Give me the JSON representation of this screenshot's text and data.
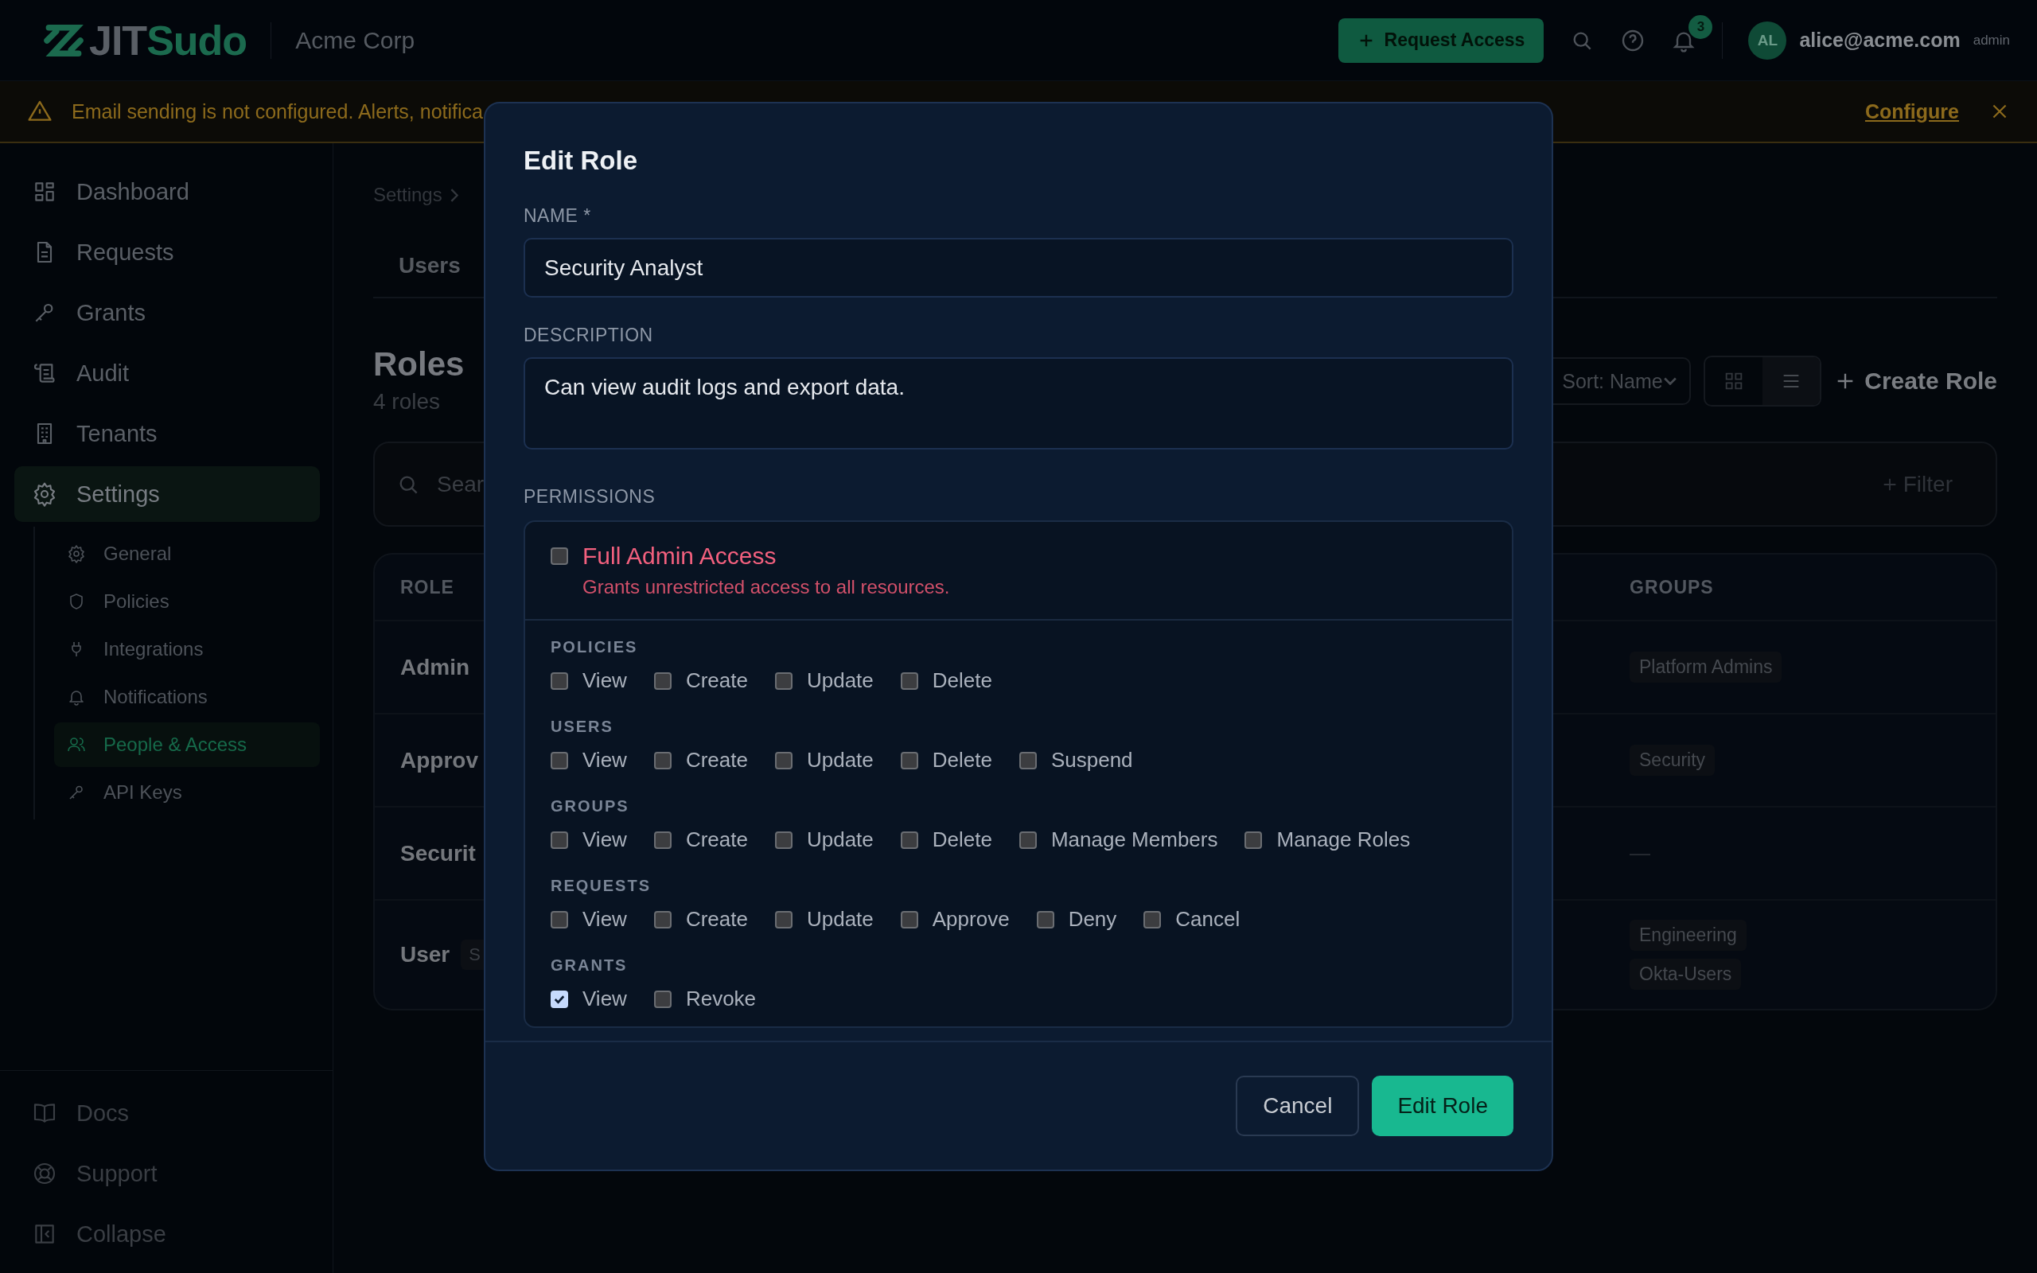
{
  "header": {
    "logo": [
      "JIT",
      "Sudo"
    ],
    "org": "Acme Corp",
    "request_button": "Request Access",
    "notification_count": "3",
    "user": {
      "initials": "AL",
      "email": "alice@acme.com",
      "role": "admin"
    }
  },
  "banner": {
    "message": "Email sending is not configured. Alerts, notifica",
    "link": "Configure"
  },
  "sidebar": {
    "items": [
      {
        "label": "Dashboard",
        "selected": false
      },
      {
        "label": "Requests",
        "selected": false
      },
      {
        "label": "Grants",
        "selected": false
      },
      {
        "label": "Audit",
        "selected": false
      },
      {
        "label": "Tenants",
        "selected": false
      },
      {
        "label": "Settings",
        "selected": true,
        "children": [
          {
            "label": "General",
            "selected": false
          },
          {
            "label": "Policies",
            "selected": false
          },
          {
            "label": "Integrations",
            "selected": false
          },
          {
            "label": "Notifications",
            "selected": false
          },
          {
            "label": "People & Access",
            "selected": true
          },
          {
            "label": "API Keys",
            "selected": false
          }
        ]
      }
    ],
    "footer": [
      "Docs",
      "Support",
      "Collapse"
    ]
  },
  "page": {
    "breadcrumb": "Settings",
    "tabs": [
      {
        "label": "Users",
        "selected": false
      }
    ],
    "title": "Roles",
    "subtitle": "4 roles",
    "sort": "Sort: Name",
    "view_modes": [
      {
        "selected": false
      },
      {
        "selected": true
      }
    ],
    "create_button": "Create Role",
    "search_placeholder": "Sear",
    "filter_button": "Filter",
    "table": {
      "columns": [
        "ROLE",
        "GROUPS"
      ],
      "rows": [
        {
          "role": "Admin",
          "groups": [
            "Platform Admins"
          ]
        },
        {
          "role": "Approv",
          "groups": [
            "Security"
          ]
        },
        {
          "role": "Securit",
          "groups_placeholder": "—"
        },
        {
          "role": "User",
          "badge": "S",
          "groups": [
            "Engineering",
            "Okta-Users"
          ]
        }
      ]
    }
  },
  "dialog": {
    "title": "Edit Role",
    "fields": [
      {
        "label": "NAME *",
        "value": "Security Analyst"
      },
      {
        "label": "DESCRIPTION",
        "value": "Can view audit logs and export data."
      }
    ],
    "permissions_label": "PERMISSIONS",
    "full_admin": {
      "label": "Full Admin Access",
      "description": "Grants unrestricted access to all resources.",
      "checked": false
    },
    "permissions": [
      {
        "name": "POLICIES",
        "options": [
          {
            "label": "View",
            "checked": false
          },
          {
            "label": "Create",
            "checked": false
          },
          {
            "label": "Update",
            "checked": false
          },
          {
            "label": "Delete",
            "checked": false
          }
        ]
      },
      {
        "name": "USERS",
        "options": [
          {
            "label": "View",
            "checked": false
          },
          {
            "label": "Create",
            "checked": false
          },
          {
            "label": "Update",
            "checked": false
          },
          {
            "label": "Delete",
            "checked": false
          },
          {
            "label": "Suspend",
            "checked": false
          }
        ]
      },
      {
        "name": "GROUPS",
        "options": [
          {
            "label": "View",
            "checked": false
          },
          {
            "label": "Create",
            "checked": false
          },
          {
            "label": "Update",
            "checked": false
          },
          {
            "label": "Delete",
            "checked": false
          },
          {
            "label": "Manage Members",
            "checked": false
          },
          {
            "label": "Manage Roles",
            "checked": false
          }
        ]
      },
      {
        "name": "REQUESTS",
        "options": [
          {
            "label": "View",
            "checked": false
          },
          {
            "label": "Create",
            "checked": false
          },
          {
            "label": "Update",
            "checked": false
          },
          {
            "label": "Approve",
            "checked": false
          },
          {
            "label": "Deny",
            "checked": false
          },
          {
            "label": "Cancel",
            "checked": false
          }
        ]
      },
      {
        "name": "GRANTS",
        "options": [
          {
            "label": "View",
            "checked": true
          },
          {
            "label": "Revoke",
            "checked": false
          }
        ]
      }
    ],
    "buttons": {
      "cancel": "Cancel",
      "submit": "Edit Role"
    }
  }
}
